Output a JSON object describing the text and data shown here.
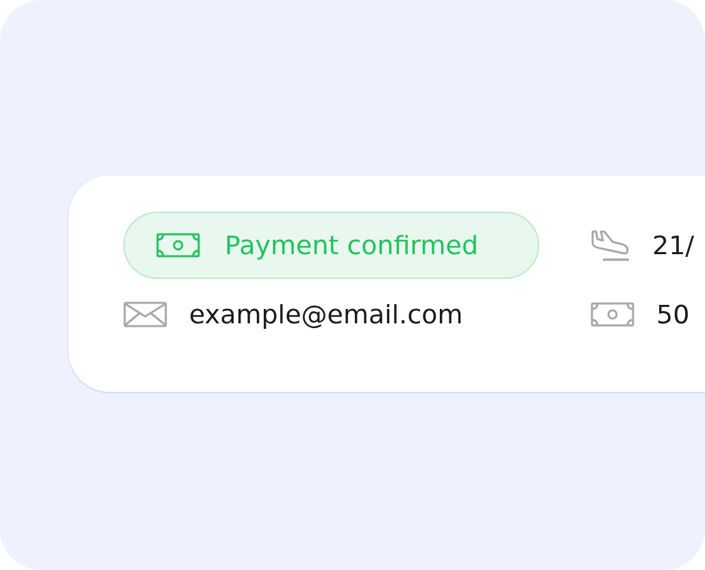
{
  "details": [
    {
      "kind": "payment_status",
      "text": "Payment confirmed"
    },
    {
      "kind": "arrival",
      "text": "21/"
    },
    {
      "kind": "email",
      "text": "example@email.com"
    },
    {
      "kind": "amount",
      "text": "50"
    }
  ]
}
